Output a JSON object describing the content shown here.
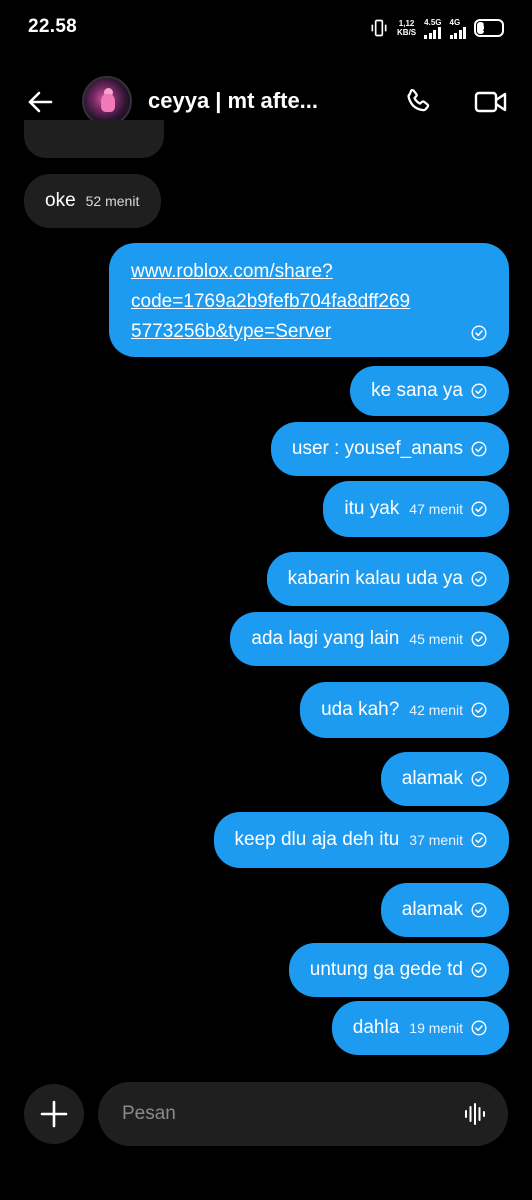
{
  "status_bar": {
    "time": "22.58",
    "net_speed_value": "1,12",
    "net_speed_unit": "KB/S",
    "sim1_label": "4.5G",
    "sim2_label": "4G",
    "battery_level": "28",
    "vibrate_icon": "vibrate-icon",
    "signal_icon": "signal-icon",
    "battery_icon": "battery-icon"
  },
  "header": {
    "title": "ceyya | mt afte...",
    "back_icon": "arrow-left-icon",
    "call_icon": "phone-icon",
    "video_icon": "video-camera-icon"
  },
  "messages": [
    {
      "direction": "received",
      "text": "oke",
      "time": "52 menit"
    },
    {
      "direction": "sent",
      "type": "link",
      "lines": [
        "www.roblox.com/share?",
        "code=1769a2b9fefb704fa8dff269",
        "5773256b&type=Server"
      ],
      "time": ""
    },
    {
      "direction": "sent",
      "text": "ke sana ya",
      "time": ""
    },
    {
      "direction": "sent",
      "text": "user : yousef_anans",
      "time": ""
    },
    {
      "direction": "sent",
      "text": "itu yak",
      "time": "47 menit"
    },
    {
      "direction": "sent",
      "text": "kabarin kalau uda ya",
      "time": ""
    },
    {
      "direction": "sent",
      "text": "ada lagi yang lain",
      "time": "45 menit"
    },
    {
      "direction": "sent",
      "text": "uda kah?",
      "time": "42 menit"
    },
    {
      "direction": "sent",
      "text": "alamak",
      "time": ""
    },
    {
      "direction": "sent",
      "text": "keep dlu aja deh itu",
      "time": "37 menit"
    },
    {
      "direction": "sent",
      "text": "alamak",
      "time": ""
    },
    {
      "direction": "sent",
      "text": "untung ga gede td",
      "time": ""
    },
    {
      "direction": "sent",
      "text": "dahla",
      "time": "19 menit"
    }
  ],
  "composer": {
    "placeholder": "Pesan",
    "value": "",
    "add_icon": "plus-icon",
    "audio_icon": "audio-waveform-icon"
  },
  "colors": {
    "background": "#000000",
    "sent_bubble": "#1d9bf0",
    "received_bubble": "#1f1f1f",
    "composer_bg": "#1f1f1f"
  }
}
